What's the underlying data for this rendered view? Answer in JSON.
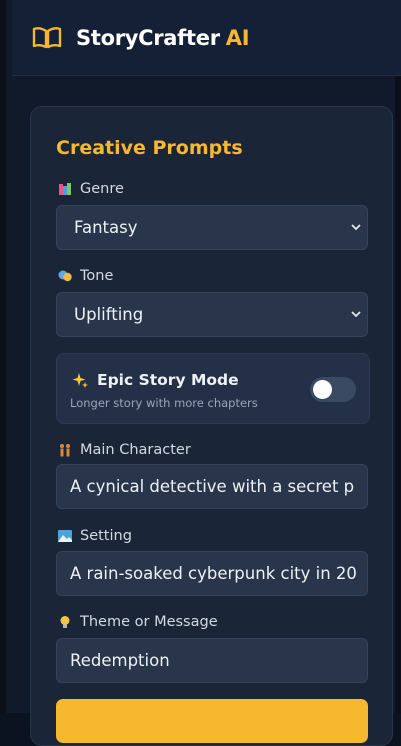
{
  "header": {
    "title_main": "StoryCrafter",
    "title_accent": "AI",
    "logo_icon": "open-book-icon"
  },
  "panel": {
    "title": "Creative Prompts",
    "genre": {
      "label": "Genre",
      "value": "Fantasy",
      "icon": "books-icon"
    },
    "tone": {
      "label": "Tone",
      "value": "Uplifting",
      "icon": "theater-masks-icon"
    },
    "epic_mode": {
      "label": "Epic Story Mode",
      "description": "Longer story with more chapters",
      "enabled": false,
      "icon": "sparkles-icon"
    },
    "main_character": {
      "label": "Main Character",
      "value": "A cynical detective with a secret p",
      "icon": "people-icon"
    },
    "setting": {
      "label": "Setting",
      "value": "A rain-soaked cyberpunk city in 20",
      "icon": "landscape-icon"
    },
    "theme": {
      "label": "Theme or Message",
      "value": "Redemption",
      "icon": "lightbulb-icon"
    }
  },
  "colors": {
    "accent": "#f5b82e",
    "panel_bg": "#1a2538",
    "field_bg": "#28354b"
  }
}
